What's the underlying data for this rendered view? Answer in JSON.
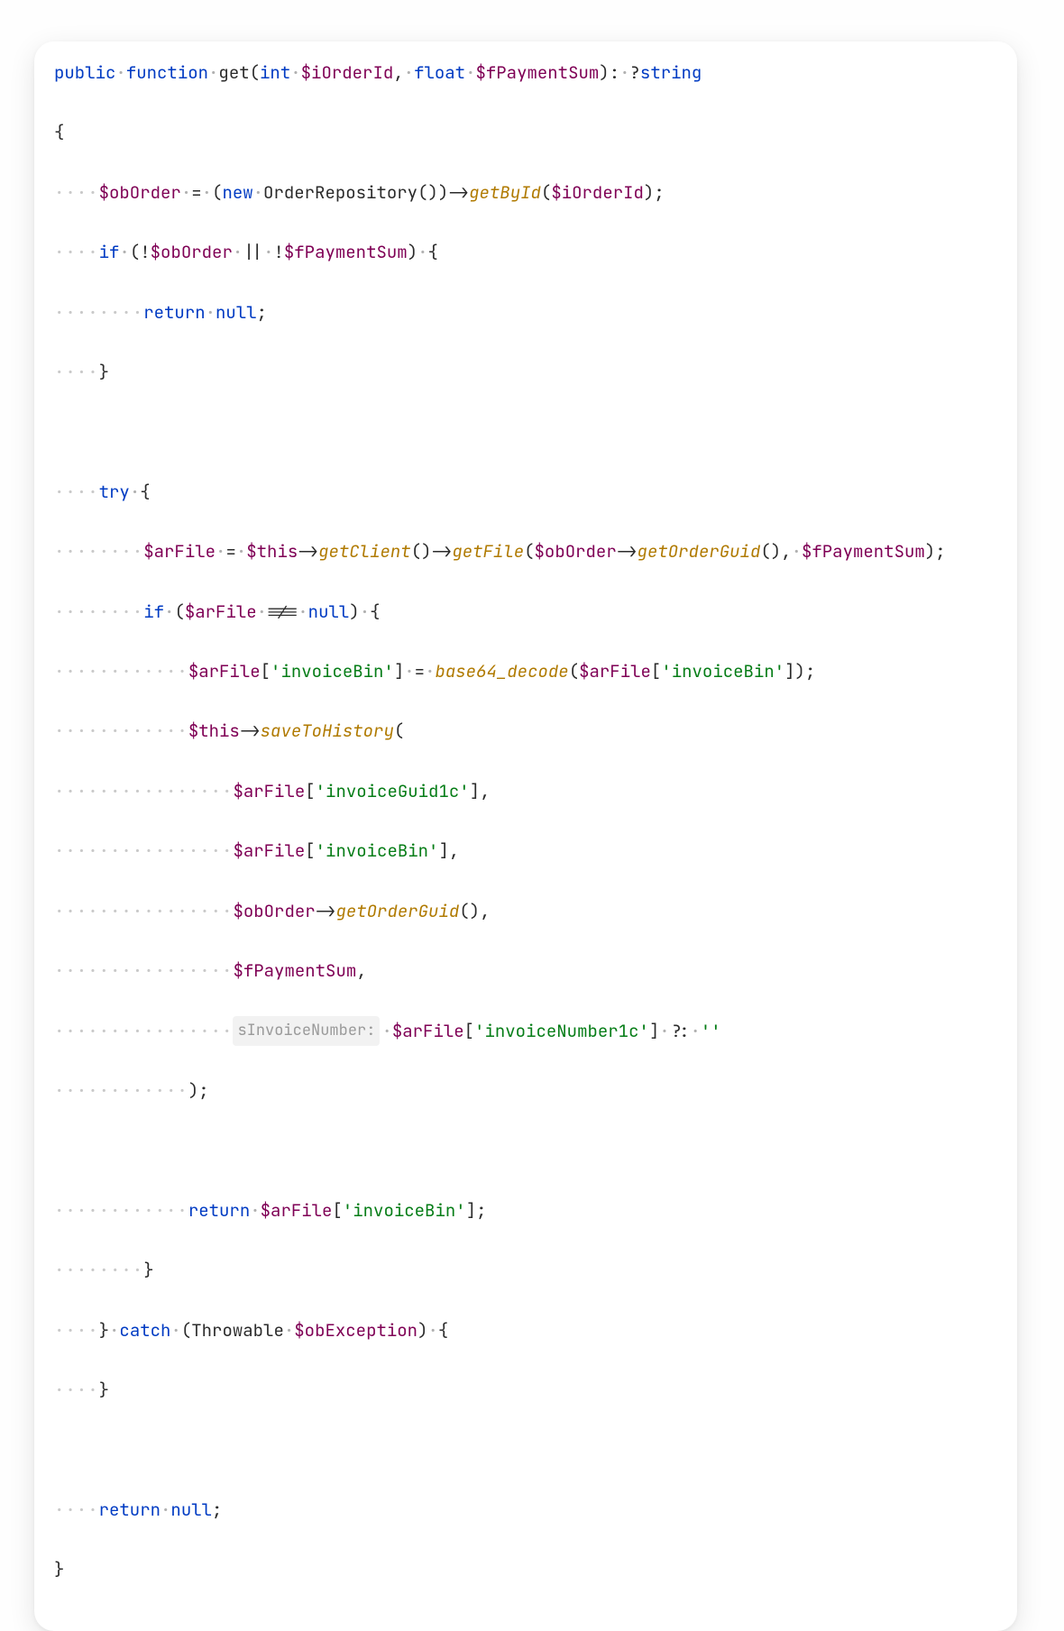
{
  "code": {
    "keywords": {
      "public": "public",
      "function": "function",
      "int": "int",
      "float": "float",
      "string": "string",
      "new": "new",
      "if": "if",
      "return": "return",
      "null": "null",
      "try": "try",
      "catch": "catch"
    },
    "identifiers": {
      "get": "get",
      "OrderRepository": "OrderRepository",
      "Throwable": "Throwable"
    },
    "vars": {
      "iOrderId": "$iOrderId",
      "fPaymentSum": "$fPaymentSum",
      "obOrder": "$obOrder",
      "arFile": "$arFile",
      "this": "$this",
      "obException": "$obException"
    },
    "calls": {
      "getById": "getById",
      "getClient": "getClient",
      "getFile": "getFile",
      "getOrderGuid": "getOrderGuid",
      "saveToHistory": "saveToHistory",
      "base64_decode": "base64_decode"
    },
    "strings": {
      "invoiceBin": "'invoiceBin'",
      "invoiceGuid1c": "'invoiceGuid1c'",
      "invoiceNumber1c": "'invoiceNumber1c'",
      "empty": "''"
    },
    "hint": {
      "sInvoiceNumber": "sInvoiceNumber:"
    },
    "punct": {
      "open_paren": "(",
      "close_paren": ")",
      "open_brace": "{",
      "close_brace": "}",
      "open_bracket": "[",
      "close_bracket": "]",
      "comma": ",",
      "semicolon": ";",
      "arrow": "->",
      "colon": ":",
      "qmark": "?",
      "assign": " = ",
      "not": "!",
      "or": " || ",
      "neq": " !== ",
      "elvis": " ?: "
    },
    "ws": {
      "ind": "····",
      "dot": "·",
      "sp": " "
    }
  }
}
